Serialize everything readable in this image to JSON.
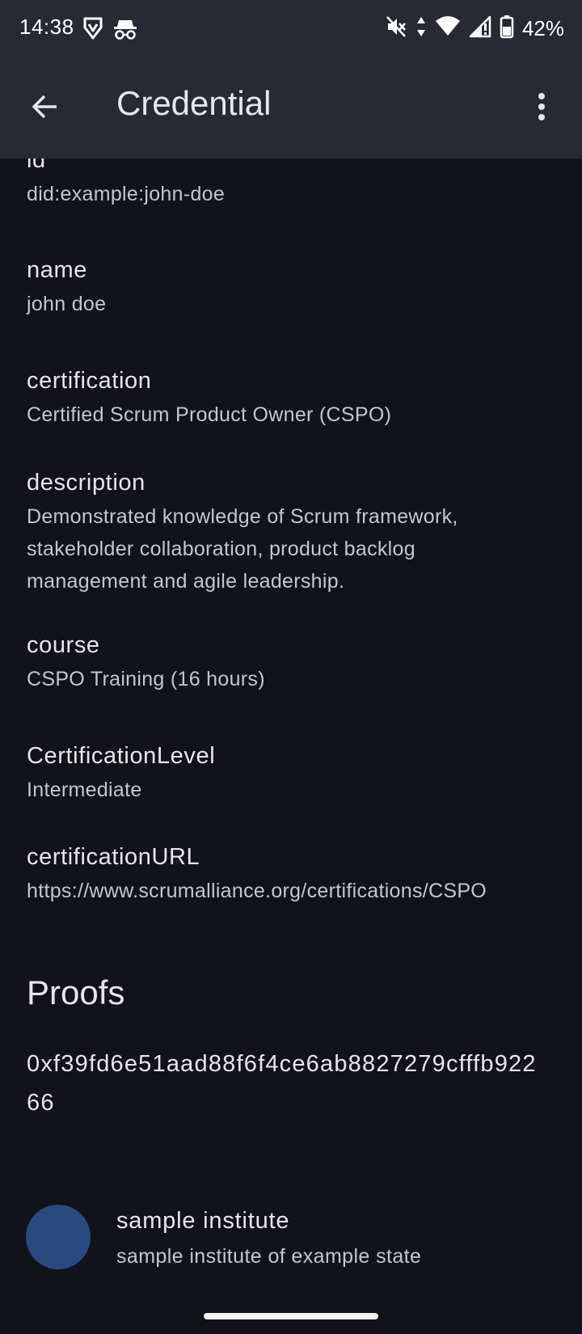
{
  "status_bar": {
    "time": "14:38",
    "left_icons": [
      "brave-icon",
      "incognito-icon"
    ],
    "right_icons": [
      "mute-icon",
      "data-arrows-icon",
      "wifi-icon",
      "signal-icon",
      "battery-icon"
    ],
    "battery_percent": "42%"
  },
  "app_bar": {
    "title": "Credential",
    "back_icon": "arrow-back-icon",
    "menu_icon": "more-vert-icon"
  },
  "fields": [
    {
      "label": "id",
      "value": "did:example:john-doe"
    },
    {
      "label": "name",
      "value": "john doe"
    },
    {
      "label": "certification",
      "value": "Certified Scrum Product Owner (CSPO)"
    },
    {
      "label": "description",
      "value": "Demonstrated knowledge of Scrum framework, stakeholder collaboration, product backlog management and agile leadership."
    },
    {
      "label": "course",
      "value": "CSPO Training (16 hours)"
    },
    {
      "label": "CertificationLevel",
      "value": "Intermediate"
    },
    {
      "label": "certificationURL",
      "value": "https://www.scrumalliance.org/certifications/CSPO"
    }
  ],
  "proofs": {
    "heading": "Proofs",
    "hash": "0xf39fd6e51aad88f6f4ce6ab8827279cfffb92266",
    "issuer": {
      "name": "sample institute",
      "description": "sample institute of example state",
      "avatar_color": "#2a4a7f"
    }
  },
  "colors": {
    "background": "#121318",
    "app_bar": "#272a34",
    "text_primary": "#e6e6ec",
    "text_secondary": "#c4c6d0"
  }
}
